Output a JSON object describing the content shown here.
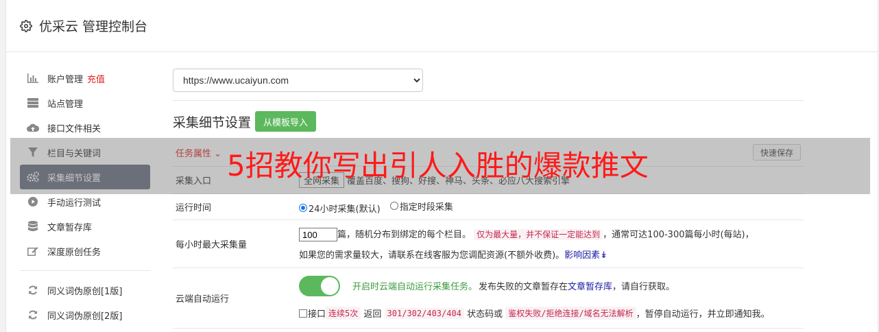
{
  "header": {
    "title": "优采云 管理控制台",
    "icon": "gear-icon"
  },
  "sidebar": {
    "items": [
      {
        "label": "账户管理",
        "badge": "充值",
        "icon": "bar-chart-icon"
      },
      {
        "label": "站点管理",
        "icon": "server-icon"
      },
      {
        "label": "接口文件相关",
        "icon": "cloud-upload-icon"
      },
      {
        "label": "栏目与关键词",
        "icon": "filter-icon"
      },
      {
        "label": "采集细节设置",
        "icon": "gears-icon",
        "active": true
      },
      {
        "label": "手动运行测试",
        "icon": "play-circle-icon"
      },
      {
        "label": "文章暂存库",
        "icon": "database-icon"
      },
      {
        "label": "深度原创任务",
        "icon": "edit-icon"
      },
      {
        "label": "同义词伪原创[1版]",
        "icon": "refresh-icon"
      },
      {
        "label": "同义词伪原创[2版]",
        "icon": "refresh-icon"
      }
    ]
  },
  "site_select": {
    "value": "https://www.ucaiyun.com"
  },
  "section": {
    "title": "采集细节设置",
    "import_button": "从模板导入"
  },
  "task": {
    "attr_label": "任务属性",
    "quick_save": "快速保存"
  },
  "entry": {
    "label": "采集入口",
    "box": "全网采集",
    "text": "覆盖百度、搜狗、好搜、神马、头条、必应八大搜索引擎"
  },
  "runtime": {
    "label": "运行时间",
    "option1": "24小时采集(默认)",
    "option2": "指定时段采集",
    "selected": "option1"
  },
  "max_per_hour": {
    "label": "每小时最大采集量",
    "value": "100",
    "text1": "篇，随机分布到绑定的每个栏目。",
    "code1": "仅为最大量，并不保证一定能达到",
    "text2": "，通常可达100-300篇每小时(每站)，",
    "text3": "如果您的需求量较大，请联系在线客服为您调配资源(不额外收费)。",
    "link": "影响因素",
    "link_icon": "double-chevron-down-icon"
  },
  "cloud": {
    "label": "云端自动运行",
    "toggle_on": true,
    "strong": "开启时云端自动运行采集任务。",
    "text1": "发布失败的文章暂存在",
    "link": "文章暂存库",
    "text2": "，请自行获取。",
    "chk_label": "接口",
    "code1": "连续5次",
    "text3": "返回",
    "code2": "301/302/403/404",
    "text4": "状态码或",
    "code3": "鉴权失败/拒绝连接/域名无法解析",
    "text5": "，暂停自动运行，并立即通知我。"
  },
  "overlay": {
    "text": "5招教你写出引人入胜的爆款推文"
  },
  "colors": {
    "accent_green": "#5cb85c",
    "active_nav": "#6a7180",
    "red": "#e02020",
    "overlay_red": "#ff1a1a"
  }
}
